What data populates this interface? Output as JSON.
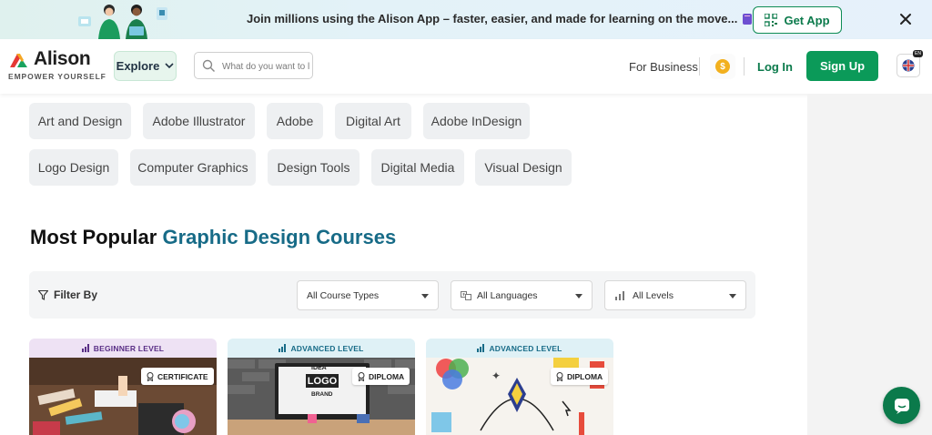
{
  "promo": {
    "text": "Join millions using the Alison App – faster, easier, and made for learning on the move...",
    "cta": "Get App"
  },
  "header": {
    "logo_word": "Alison",
    "logo_tagline": "EMPOWER YOURSELF",
    "explore_label": "Explore",
    "search_placeholder": "What do you want to l",
    "for_business": "For Business",
    "coin_symbol": "$",
    "login": "Log In",
    "signup": "Sign Up",
    "lang_badge": "EN"
  },
  "tags": [
    "Art and Design",
    "Adobe Illustrator",
    "Adobe",
    "Digital Art",
    "Adobe InDesign",
    "Logo Design",
    "Computer Graphics",
    "Design Tools",
    "Digital Media",
    "Visual Design"
  ],
  "section": {
    "title_plain": "Most Popular ",
    "title_accent": "Graphic Design Courses"
  },
  "filters": {
    "label": "Filter By",
    "course_types": "All Course Types",
    "languages": "All Languages",
    "levels": "All Levels"
  },
  "cards": [
    {
      "level": "BEGINNER LEVEL",
      "badge": "CERTIFICATE",
      "head_bg": "#eee2f4",
      "head_color": "#5a2f86",
      "logo_text": ""
    },
    {
      "level": "ADVANCED LEVEL",
      "badge": "DIPLOMA",
      "head_bg": "#dff1f6",
      "head_color": "#176b87",
      "logo_text": "IDEA",
      "logo_main": "LOGO",
      "logo_sub": "BRAND"
    },
    {
      "level": "ADVANCED LEVEL",
      "badge": "DIPLOMA",
      "head_bg": "#dff1f6",
      "head_color": "#176b87"
    }
  ],
  "colors": {
    "brand_green": "#0b9a59",
    "accent_blue": "#176b87"
  }
}
